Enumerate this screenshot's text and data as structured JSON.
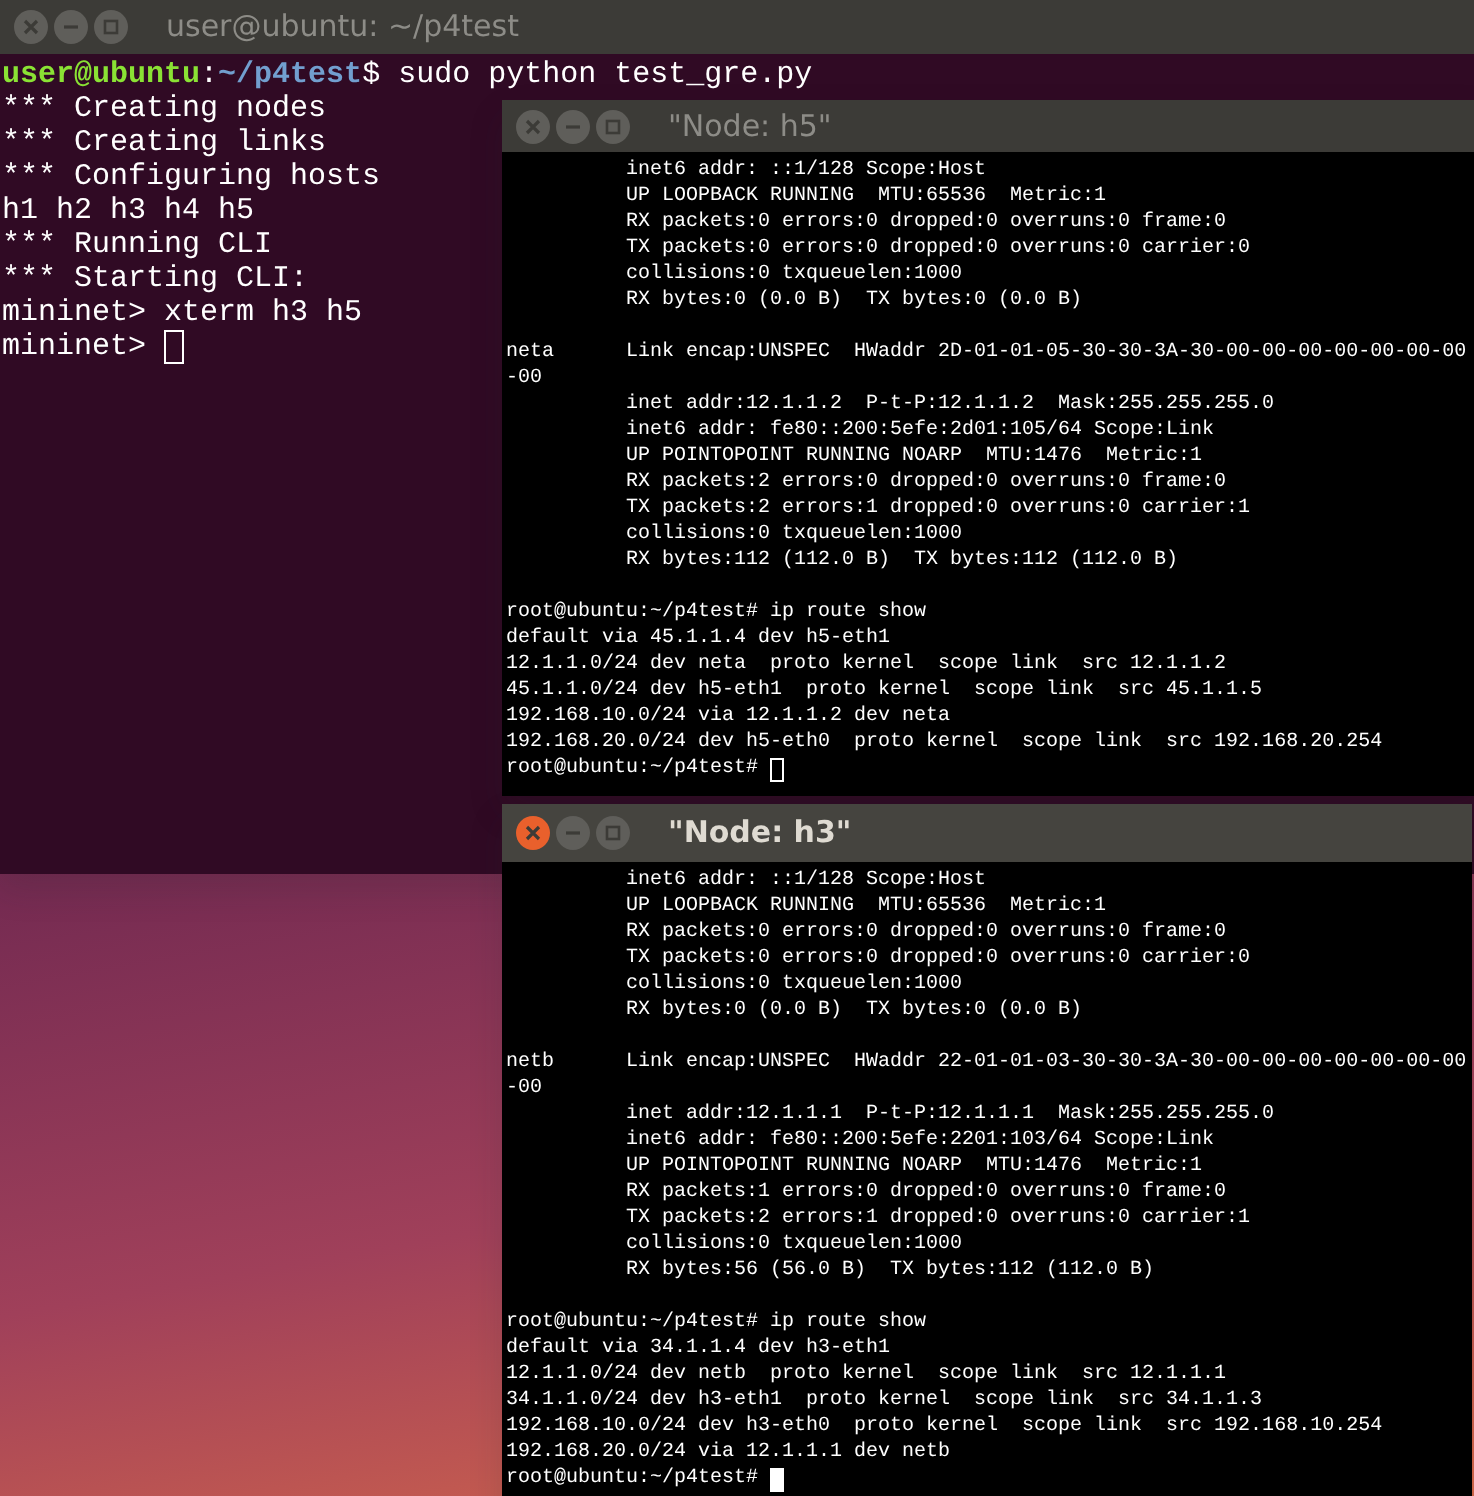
{
  "windows": [
    {
      "kind": "gnome-terminal",
      "title": "user@ubuntu: ~/p4test",
      "active": false,
      "blocks": [
        [
          {
            "segments": [
              {
                "kind": "user",
                "text": "user@ubuntu"
              },
              {
                "kind": "plain",
                "text": ":"
              },
              {
                "kind": "path",
                "text": "~/p4test"
              },
              {
                "kind": "plain",
                "text": "$ sudo python test_gre.py"
              }
            ]
          },
          "*** Creating nodes",
          "*** Creating links",
          "*** Configuring hosts",
          "h1 h2 h3 h4 h5",
          "*** Running CLI",
          "*** Starting CLI:",
          "mininet> xterm h3 h5"
        ]
      ],
      "prompt": "mininet>",
      "cursor": {
        "focused": false
      }
    },
    {
      "kind": "xterm",
      "title": "\"Node: h5\"",
      "active": false,
      "blocks": [
        [
          "          inet6 addr: ::1/128 Scope:Host",
          "          UP LOOPBACK RUNNING  MTU:65536  Metric:1",
          "          RX packets:0 errors:0 dropped:0 overruns:0 frame:0",
          "          TX packets:0 errors:0 dropped:0 overruns:0 carrier:0",
          "          collisions:0 txqueuelen:1000",
          "          RX bytes:0 (0.0 B)  TX bytes:0 (0.0 B)"
        ],
        [
          "neta      Link encap:UNSPEC  HWaddr 2D-01-01-05-30-30-3A-30-00-00-00-00-00-00-00",
          "-00",
          "          inet addr:12.1.1.2  P-t-P:12.1.1.2  Mask:255.255.255.0",
          "          inet6 addr: fe80::200:5efe:2d01:105/64 Scope:Link",
          "          UP POINTOPOINT RUNNING NOARP  MTU:1476  Metric:1",
          "          RX packets:2 errors:0 dropped:0 overruns:0 frame:0",
          "          TX packets:2 errors:1 dropped:0 overruns:0 carrier:1",
          "          collisions:0 txqueuelen:1000",
          "          RX bytes:112 (112.0 B)  TX bytes:112 (112.0 B)"
        ],
        [
          "root@ubuntu:~/p4test# ip route show",
          "default via 45.1.1.4 dev h5-eth1",
          "12.1.1.0/24 dev neta  proto kernel  scope link  src 12.1.1.2",
          "45.1.1.0/24 dev h5-eth1  proto kernel  scope link  src 45.1.1.5",
          "192.168.10.0/24 via 12.1.1.2 dev neta",
          "192.168.20.0/24 dev h5-eth0  proto kernel  scope link  src 192.168.20.254"
        ]
      ],
      "prompt": "root@ubuntu:~/p4test#",
      "cursor": {
        "focused": false
      }
    },
    {
      "kind": "xterm",
      "title": "\"Node: h3\"",
      "active": true,
      "blocks": [
        [
          "          inet6 addr: ::1/128 Scope:Host",
          "          UP LOOPBACK RUNNING  MTU:65536  Metric:1",
          "          RX packets:0 errors:0 dropped:0 overruns:0 frame:0",
          "          TX packets:0 errors:0 dropped:0 overruns:0 carrier:0",
          "          collisions:0 txqueuelen:1000",
          "          RX bytes:0 (0.0 B)  TX bytes:0 (0.0 B)"
        ],
        [
          "netb      Link encap:UNSPEC  HWaddr 22-01-01-03-30-30-3A-30-00-00-00-00-00-00-00",
          "-00",
          "          inet addr:12.1.1.1  P-t-P:12.1.1.1  Mask:255.255.255.0",
          "          inet6 addr: fe80::200:5efe:2201:103/64 Scope:Link",
          "          UP POINTOPOINT RUNNING NOARP  MTU:1476  Metric:1",
          "          RX packets:1 errors:0 dropped:0 overruns:0 frame:0",
          "          TX packets:2 errors:1 dropped:0 overruns:0 carrier:1",
          "          collisions:0 txqueuelen:1000",
          "          RX bytes:56 (56.0 B)  TX bytes:112 (112.0 B)"
        ],
        [
          "root@ubuntu:~/p4test# ip route show",
          "default via 34.1.1.4 dev h3-eth1",
          "12.1.1.0/24 dev netb  proto kernel  scope link  src 12.1.1.1",
          "34.1.1.0/24 dev h3-eth1  proto kernel  scope link  src 34.1.1.3",
          "192.168.10.0/24 dev h3-eth0  proto kernel  scope link  src 192.168.10.254",
          "192.168.20.0/24 via 12.1.1.1 dev netb"
        ]
      ],
      "prompt": "root@ubuntu:~/p4test#",
      "cursor": {
        "focused": true
      }
    }
  ]
}
